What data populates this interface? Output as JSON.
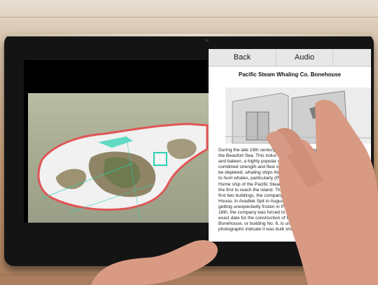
{
  "panel": {
    "tabs": {
      "back": "Back",
      "audio": "Audio"
    },
    "title": "Pacific Steam Whaling Co. Bonehouse",
    "body_lines": [
      "During the late 19th century whaling industry expanded to",
      "the Beaufort Sea. This indus                   by a demand for oil",
      "and baleen, a highly popular                  material valued for its",
      "combined strength and flexi               stocks began",
      "be depleted, whaling ships           the Mary D",
      "to hunt whales, particularly          (PSWC)",
      "Hume ship of the Pacific Steam              ling Co",
      "the first to reach the island. The           Point",
      "first two buildings, the company",
      "House, in Avadlek Spit in August T",
      "getting unexpectedly frozen in Pau",
      "18th, the company was forced to re",
      "exact date for the construction of the",
      "Bonehouse, or building No. 6, is unkno",
      "photographs indicate it was built short"
    ]
  },
  "colors": {
    "accent_ar": "#2fd1b2",
    "panel_bg": "#ffffff",
    "tabbar_bg": "#e7e7e7"
  }
}
